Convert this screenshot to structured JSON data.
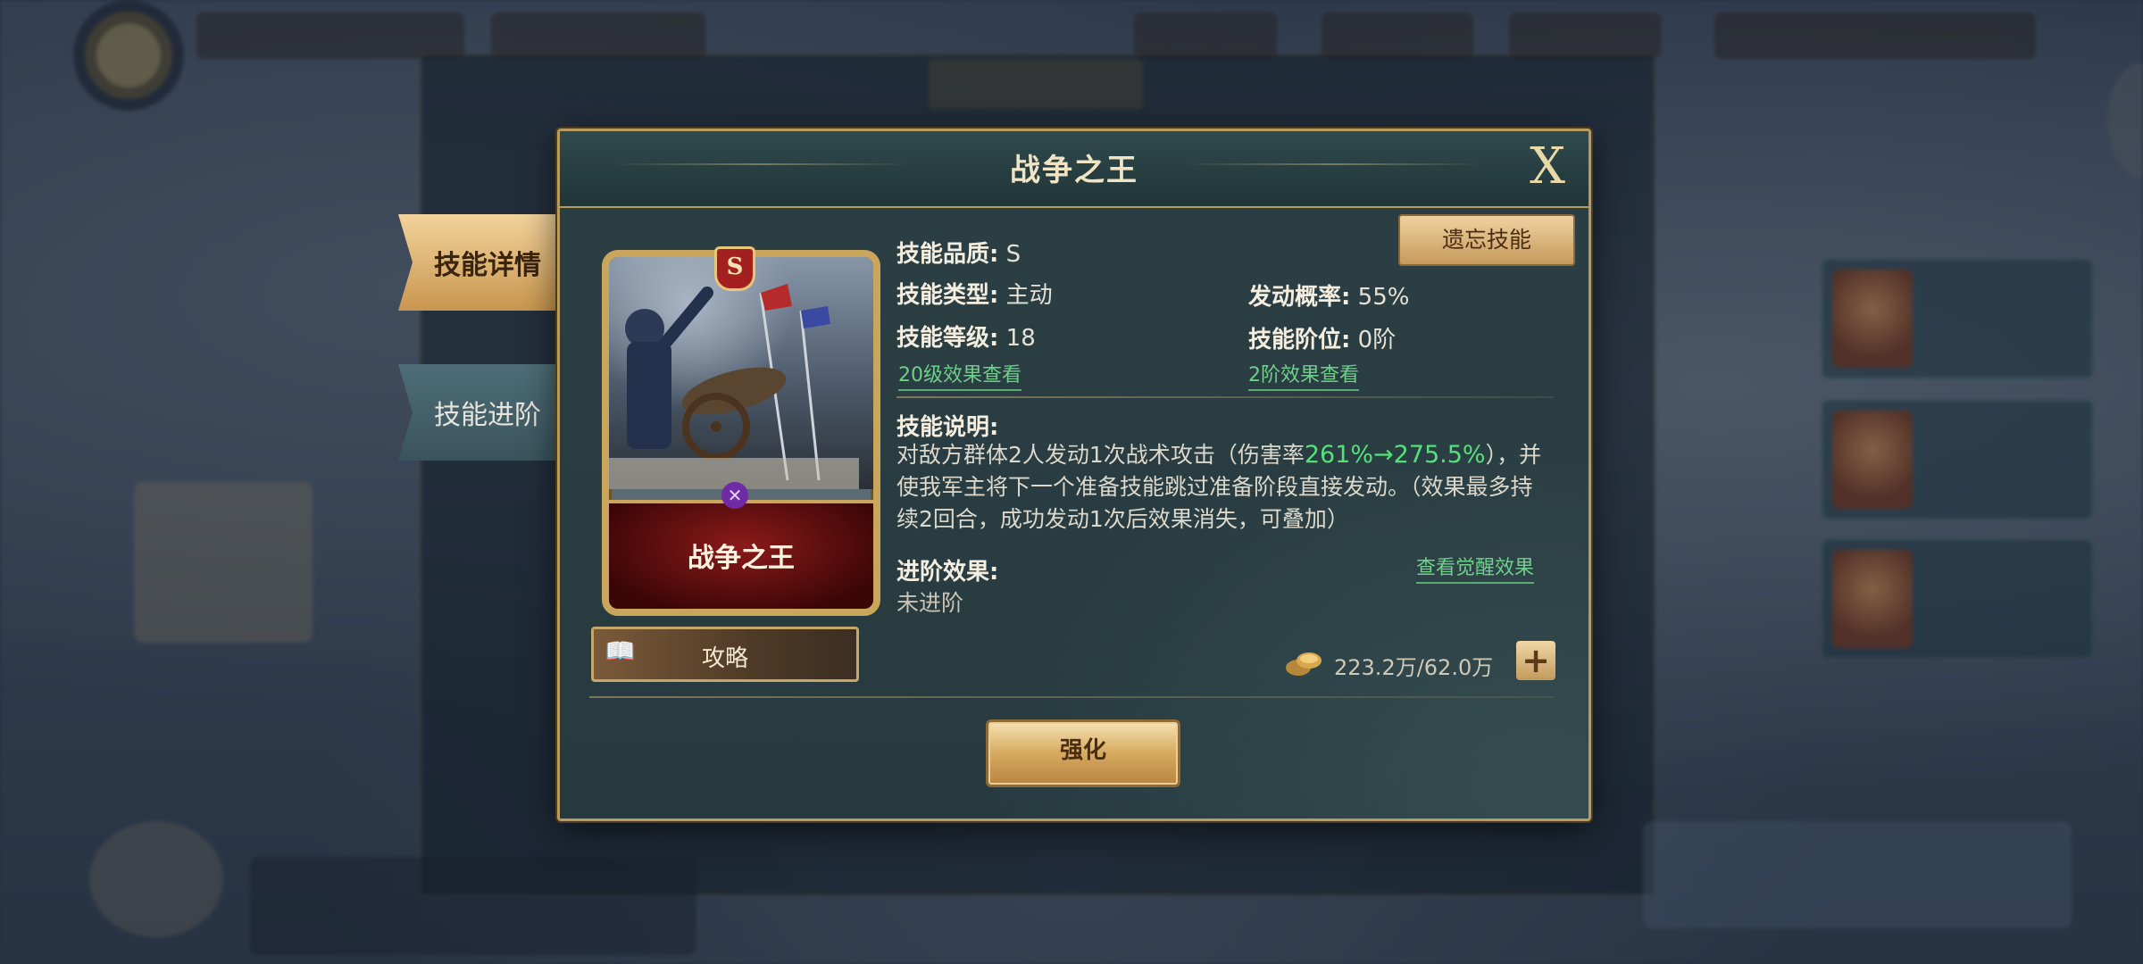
{
  "dialog": {
    "title": "战争之王",
    "close_label": "X"
  },
  "tabs": [
    {
      "label": "技能详情",
      "active": true
    },
    {
      "label": "技能进阶",
      "active": false
    }
  ],
  "card": {
    "name": "战争之王",
    "grade": "S"
  },
  "guide_button": {
    "label": "攻略"
  },
  "forget_button": {
    "label": "遗忘技能"
  },
  "skill": {
    "quality_label": "技能品质:",
    "quality_value": "S",
    "type_label": "技能类型:",
    "type_value": "主动",
    "level_label": "技能等级:",
    "level_value": "18",
    "chance_label": "发动概率:",
    "chance_value": "55%",
    "rank_label": "技能阶位:",
    "rank_value": "0阶",
    "level_effect_link": "20级效果查看",
    "rank_effect_link": "2阶效果查看"
  },
  "description": {
    "label": "技能说明:",
    "part1": "对敌方群体2人发动1次战术攻击（伤害率",
    "highlight": "261%→275.5%",
    "part2": "），并使我军主将下一个准备技能跳过准备阶段直接发动。（效果最多持续2回合，成功发动1次后效果消失，可叠加）"
  },
  "advance": {
    "label": "进阶效果:",
    "value": "未进阶",
    "awaken_link": "查看觉醒效果"
  },
  "resource": {
    "amount": "223.2万/62.0万"
  },
  "enhance_button": {
    "label": "强化"
  },
  "colors": {
    "gold_border": "#b89b5f",
    "highlight_green": "#56e07c",
    "panel_bg": "#263a3f"
  }
}
